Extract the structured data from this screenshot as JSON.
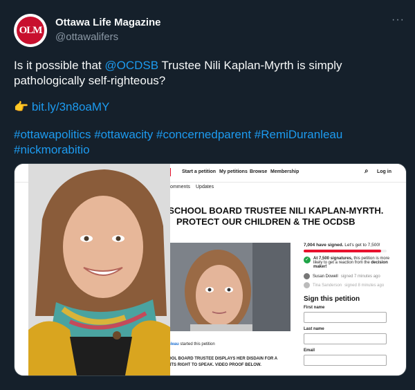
{
  "author": {
    "display_name": "Ottawa Life Magazine",
    "handle": "@ottawalifers",
    "avatar_text": "OLM"
  },
  "tweet": {
    "line1_pre": "Is it possible that ",
    "mention": "@OCDSB",
    "line1_post": " Trustee Nili Kaplan-Myrth is simply",
    "line2": "pathologically self-righteous?",
    "pointer_emoji": "👉",
    "short_link": "bit.ly/3n8oaMY",
    "hashtags_line1": "#ottawapolitics #ottawacity #concernedparent #RemiDuranleau",
    "hashtags_line2": "#nickmorabitio"
  },
  "media": {
    "nav": {
      "start": "Start a petition",
      "my": "My petitions",
      "browse": "Browse",
      "membership": "Membership",
      "login": "Log in"
    },
    "tabs": {
      "comments": "Comments",
      "updates": "Updates"
    },
    "headline_line1": "E SCHOOL BOARD TRUSTEE NILI KAPLAN-MYRTH.",
    "headline_line2": "PROTECT OUR CHILDREN & THE OCDSB",
    "signed_count": "7,004 have signed.",
    "signed_goal": "Let's get to 7,500!",
    "signed_progress": 0.934,
    "milestone_bold": "At 7,500 signatures,",
    "milestone_rest": "this petition is more likely to get a reaction from the",
    "milestone_target": "decision maker!",
    "signer1_name": "Susan Dowell",
    "signer1_time": "signed 7 minutes ago",
    "signer2_name": "Tina Sanderson",
    "signer2_time": "signed 8 minutes ago",
    "sign_heading": "Sign this petition",
    "field_first": "First name",
    "field_last": "Last name",
    "field_email": "Email",
    "starter_name": "nleau",
    "starter_rest": "started this petition",
    "body_line1": "OOL BOARD TRUSTEE DISPLAYS HER DISDAIN FOR A",
    "body_line2": "NTS RIGHT TO SPEAK. VIDEO PROOF BELOW."
  },
  "colors": {
    "background": "#15202b",
    "link": "#1d9bf0",
    "secondary_text": "#8b98a5",
    "brand_red": "#c8102e"
  }
}
